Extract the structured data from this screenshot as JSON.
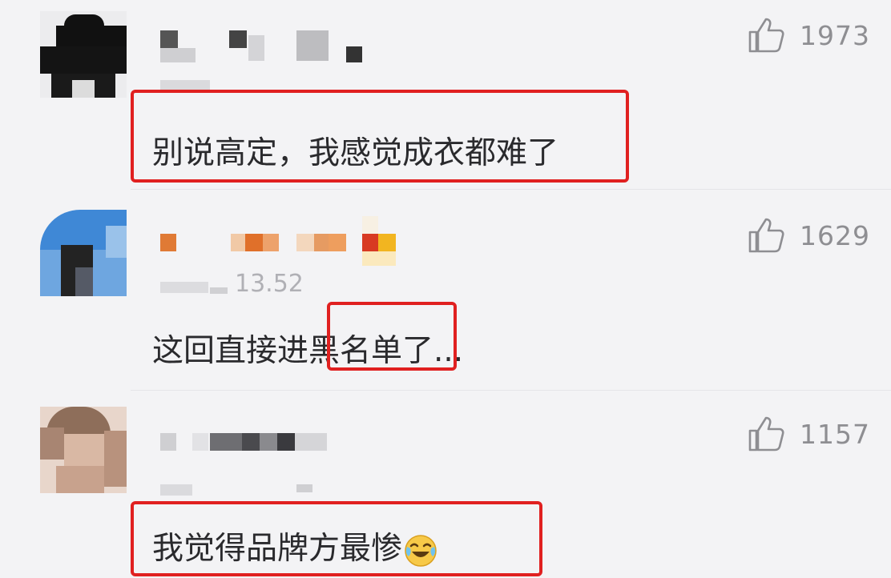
{
  "comments": [
    {
      "likes": "1973",
      "text": "别说高定，我感觉成衣都难了",
      "icon": "thumbs-up-icon"
    },
    {
      "likes": "1629",
      "timestamp_fragment": "13.52",
      "text": "这回直接进黑名单了...",
      "icon": "thumbs-up-icon"
    },
    {
      "likes": "1157",
      "text": "我觉得品牌方最惨",
      "emoji": "laughing-crying-emoji",
      "icon": "thumbs-up-icon"
    }
  ],
  "colors": {
    "background": "#f3f3f5",
    "highlight_box": "#e02020",
    "text": "#2a2a2d",
    "like_count": "#8e8e92"
  }
}
